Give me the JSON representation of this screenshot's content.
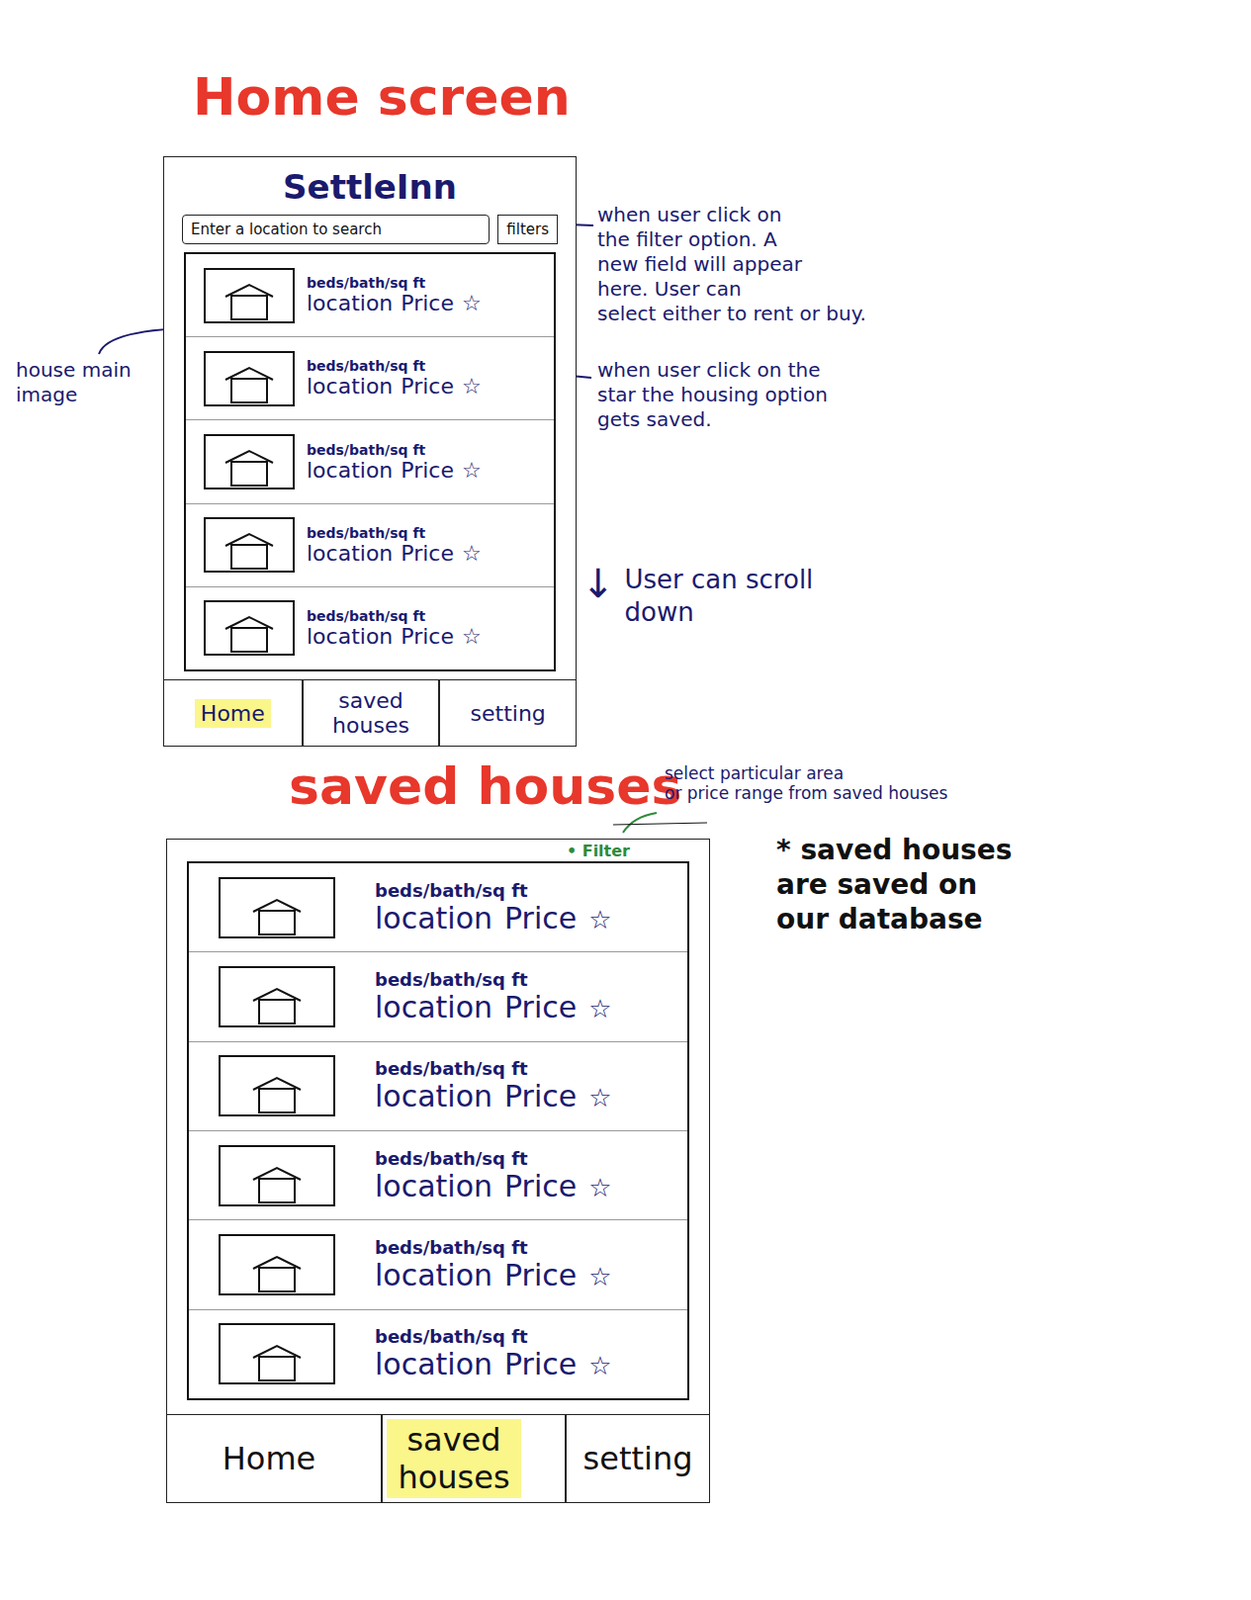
{
  "home_screen": {
    "title": "Home screen",
    "app_name": "SettleInn",
    "search": {
      "placeholder": "Enter a location to search"
    },
    "filter_button": "filters",
    "listings": [
      {
        "details": "beds/bath/sq ft",
        "location": "location",
        "price": "Price",
        "star": "☆"
      },
      {
        "details": "beds/bath/sq ft",
        "location": "location",
        "price": "Price",
        "star": "☆"
      },
      {
        "details": "beds/bath/sq ft",
        "location": "location",
        "price": "Price",
        "star": "☆"
      },
      {
        "details": "beds/bath/sq ft",
        "location": "location",
        "price": "Price",
        "star": "☆"
      },
      {
        "details": "beds/bath/sq ft",
        "location": "location",
        "price": "Price",
        "star": "☆"
      }
    ],
    "tabs": [
      {
        "label": "Home",
        "selected": true
      },
      {
        "label": "saved houses",
        "selected": false
      },
      {
        "label": "setting",
        "selected": false
      }
    ]
  },
  "saved_screen": {
    "title": "saved houses",
    "filter_link": {
      "bullet": "•",
      "label": "Filter"
    },
    "listings": [
      {
        "details": "beds/bath/sq ft",
        "location": "location",
        "price": "Price",
        "star": "☆"
      },
      {
        "details": "beds/bath/sq ft",
        "location": "location",
        "price": "Price",
        "star": "☆"
      },
      {
        "details": "beds/bath/sq ft",
        "location": "location",
        "price": "Price",
        "star": "☆"
      },
      {
        "details": "beds/bath/sq ft",
        "location": "location",
        "price": "Price",
        "star": "☆"
      },
      {
        "details": "beds/bath/sq ft",
        "location": "location",
        "price": "Price",
        "star": "☆"
      },
      {
        "details": "beds/bath/sq ft",
        "location": "location",
        "price": "Price",
        "star": "☆"
      }
    ],
    "tabs": [
      {
        "label": "Home",
        "selected": false
      },
      {
        "label": "saved houses",
        "selected": true
      },
      {
        "label": "setting",
        "selected": false
      }
    ]
  },
  "annotations": {
    "filter_option": [
      "when user click on",
      "the filter option. A",
      "new field will appear",
      "here. User can",
      "select either to rent or buy."
    ],
    "house_image": [
      "house main",
      "image"
    ],
    "star_save": [
      "when user click on the",
      "star the housing option",
      "gets saved."
    ],
    "scroll": {
      "arrow": "↓",
      "lines": [
        "User can scroll",
        "down"
      ]
    },
    "saved_filter": [
      "select particular area",
      "or price range from saved houses"
    ],
    "database": [
      "* saved houses",
      "are saved on",
      "our database"
    ]
  }
}
